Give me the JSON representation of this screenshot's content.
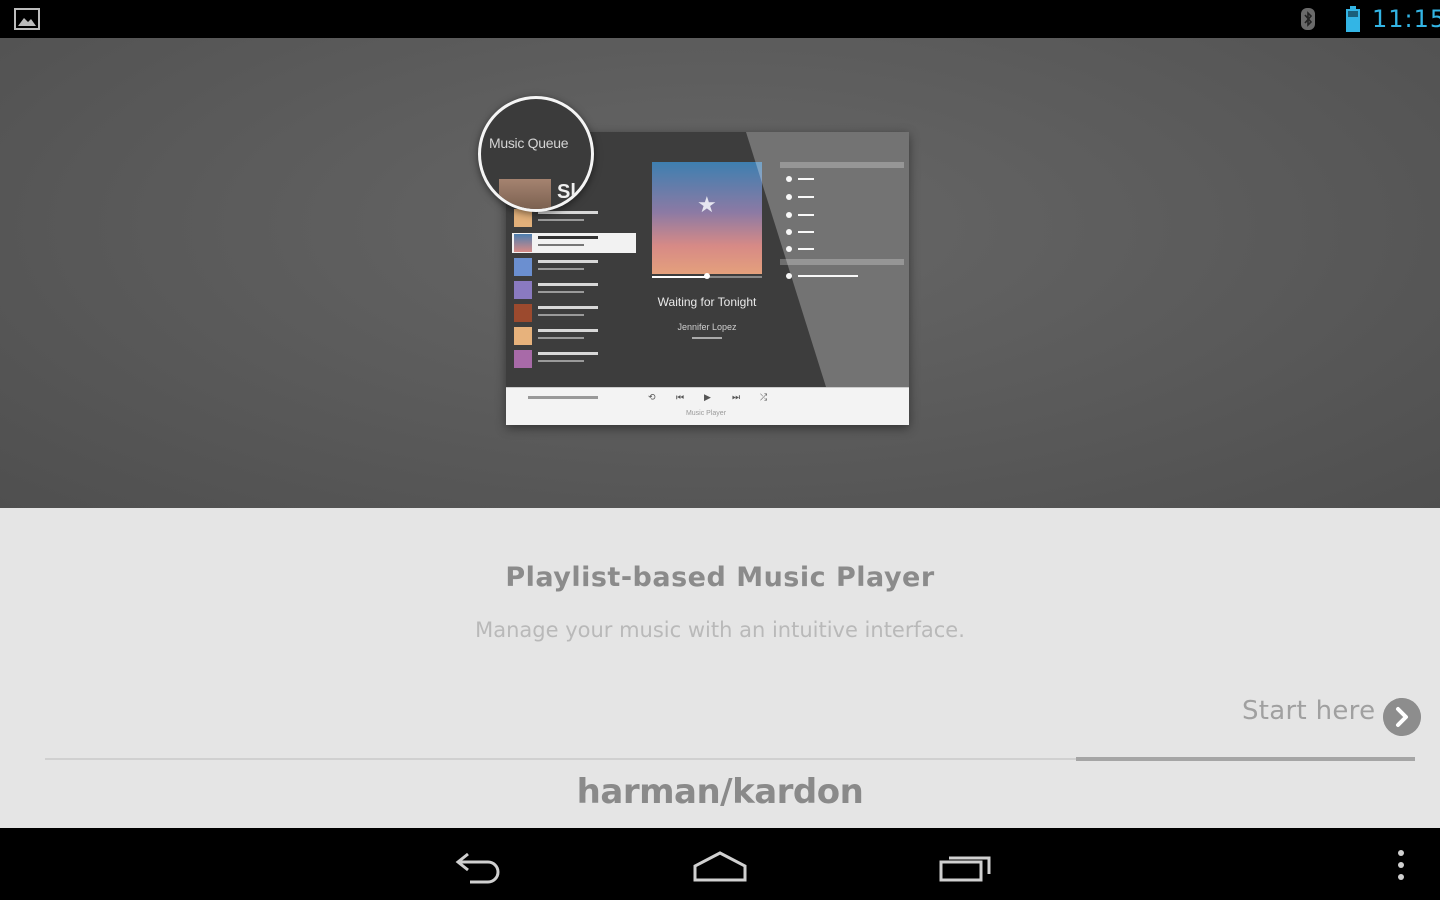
{
  "status_bar": {
    "time": "11:15",
    "icons": [
      "gallery-notification-icon",
      "bluetooth-icon",
      "battery-icon"
    ],
    "time_color": "#33b5e5"
  },
  "preview": {
    "magnifier_title": "Music Queue",
    "magnifier_song_fragment": "Sl",
    "now_playing_title": "Waiting for Tonight",
    "now_playing_artist": "Jennifer Lopez",
    "control_bar_label": "Music Player"
  },
  "onboarding": {
    "title": "Playlist-based Music Player",
    "subtitle": "Manage your music with an intuitive interface.",
    "start_label": "Start here",
    "start_icon": "chevron-right-icon",
    "page_progress": 0.25
  },
  "brand": {
    "logo_text": "harman/kardon"
  },
  "nav_bar": {
    "buttons": [
      "back-icon",
      "home-icon",
      "recent-apps-icon",
      "overflow-menu-icon"
    ]
  }
}
